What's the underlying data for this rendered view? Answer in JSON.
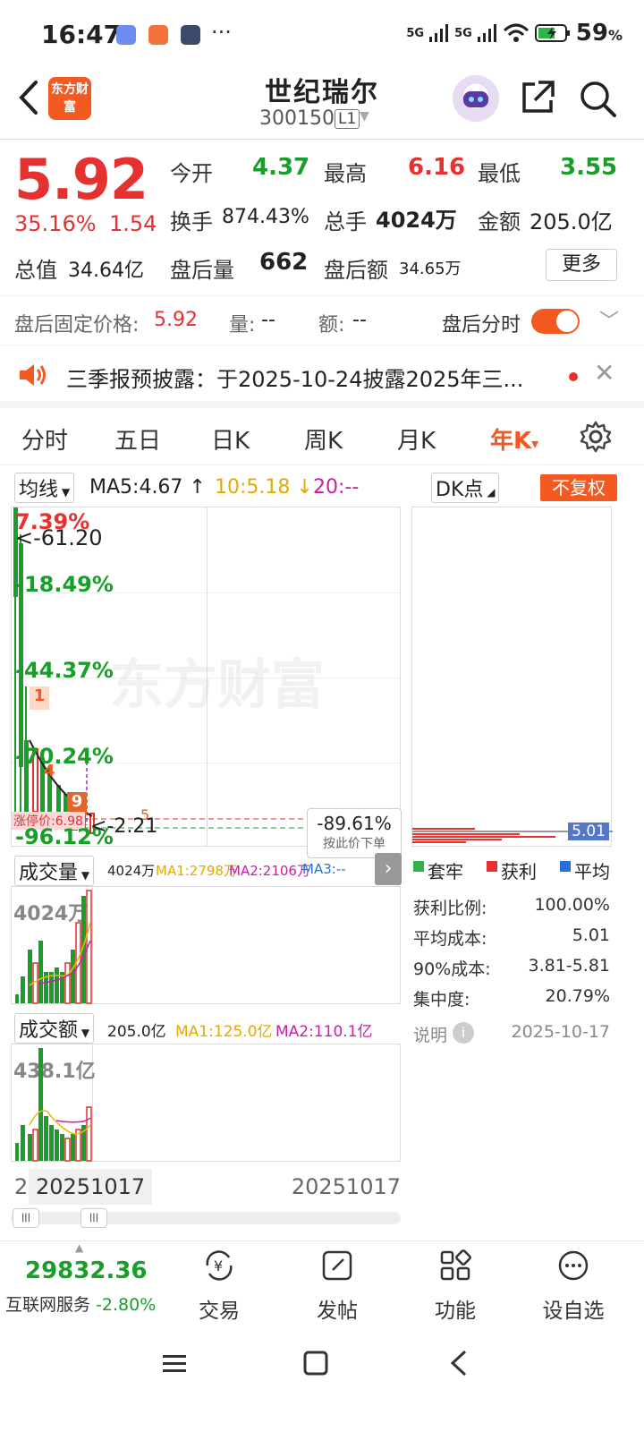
{
  "status_bar": {
    "time": "16:47",
    "dots": "···",
    "net1": "5G",
    "net2": "5G",
    "battery": "59"
  },
  "header": {
    "logo_text": "东方财富",
    "stock_name": "世纪瑞尔",
    "stock_code": "300150",
    "code_tag": "L1",
    "icons": [
      "back-arrow-icon",
      "ai-robot-icon",
      "share-icon",
      "search-icon"
    ]
  },
  "quote": {
    "price": "5.92",
    "change_pct": "35.16%",
    "change_abs": "1.54",
    "open_label": "今开",
    "open_val": "4.37",
    "high_label": "最高",
    "high_val": "6.16",
    "low_label": "最低",
    "low_val": "3.55",
    "turnover_label": "换手",
    "turnover_val": "874.43%",
    "volume_label": "总手",
    "volume_val": "4024万",
    "amount_label": "金额",
    "amount_val": "205.0亿",
    "mktcap_label": "总值",
    "mktcap_val": "34.64亿",
    "ah_vol_label": "盘后量",
    "ah_vol_val": "662",
    "ah_amt_label": "盘后额",
    "ah_amt_val": "34.65万",
    "more_label": "更多"
  },
  "after_hours": {
    "fixed_price_label": "盘后固定价格:",
    "fixed_price_val": "5.92",
    "vol_label": "量:",
    "vol_val": "--",
    "amt_label": "额:",
    "amt_val": "--",
    "timeshare_label": "盘后分时",
    "toggle_on": true
  },
  "notice": {
    "text": "三季报预披露：于2025-10-24披露2025年三..."
  },
  "tabs": [
    "分时",
    "五日",
    "日K",
    "周K",
    "月K",
    "年K"
  ],
  "tab_active_index": 5,
  "tab_caret": "▾",
  "ma_row": {
    "dropdown": "均线",
    "ma5": "MA5:4.67",
    "ma5_arrow": "↑",
    "ma10": "10:5.18",
    "ma10_arrow": "↓",
    "ma20": "20:--",
    "dk_label": "DK点",
    "fq_label": "不复权"
  },
  "kchart": {
    "watermark": "东方财富",
    "labels": {
      "top_pct": "7.39%",
      "max_marker": "<-61.20",
      "pct1": "-18.49%",
      "pct2": "-44.37%",
      "pct3": "-70.24%",
      "pct4": "-96.12%",
      "low_marker": "<-2.21",
      "limit_text": "涨停价:6.98",
      "badge1": "1",
      "badge4": "4",
      "badge9": "9",
      "badge5": "5",
      "cursor_pct": "-89.61%",
      "cursor_hint": "按此价下单"
    }
  },
  "volume": {
    "dropdown": "成交量",
    "total": "4024万",
    "ma1": "MA1:2798万",
    "ma2": "MA2:2106万",
    "ma3": "MA3:--",
    "max_label": "4024万"
  },
  "amount": {
    "dropdown": "成交额",
    "total": "205.0亿",
    "ma1": "MA1:125.0亿",
    "ma2": "MA2:110.1亿",
    "max_label": "438.1亿"
  },
  "x_axis": {
    "left_char": "2",
    "cursor_date": "20251017",
    "right_date": "20251017"
  },
  "chips": {
    "price_tag": "5.01",
    "legend": [
      "套牢",
      "获利",
      "平均"
    ],
    "rows": [
      {
        "label": "获利比例:",
        "value": "100.00%"
      },
      {
        "label": "平均成本:",
        "value": "5.01"
      },
      {
        "label": "90%成本:",
        "value": "3.81-5.81"
      },
      {
        "label": "集中度:",
        "value": "20.79%"
      }
    ],
    "note_label": "说明",
    "date": "2025-10-17"
  },
  "bottom_nav": {
    "index_val": "29832.36",
    "index_name": "互联网服务",
    "index_chg": "-2.80%",
    "items": [
      "交易",
      "发帖",
      "功能",
      "设自选"
    ]
  }
}
